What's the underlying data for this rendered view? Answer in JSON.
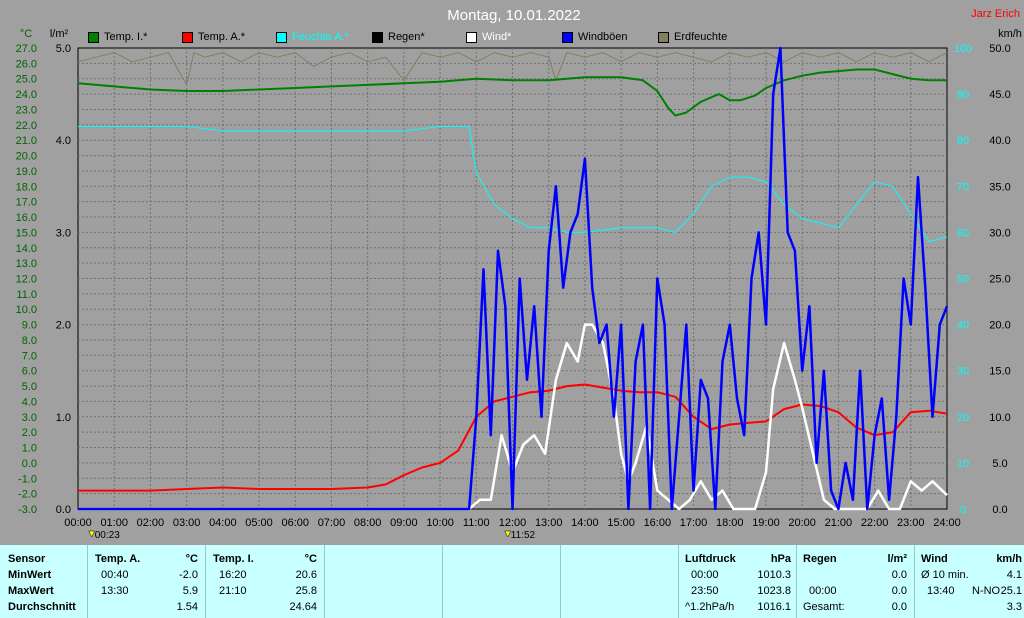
{
  "header": {
    "title": "Montag, 10.01.2022",
    "author": "Jarz Erich"
  },
  "units": {
    "temp": "°C",
    "rain": "l/m²",
    "wind": "km/h"
  },
  "legend": [
    {
      "label": "Temp. I.*",
      "color": "#008000"
    },
    {
      "label": "Temp. A.*",
      "color": "#ff0000"
    },
    {
      "label": "Feuchte A.*",
      "color": "#00ffff"
    },
    {
      "label": "Regen*",
      "color": "#000000"
    },
    {
      "label": "Wind*",
      "color": "#ffffff"
    },
    {
      "label": "Windböen",
      "color": "#0000ff"
    },
    {
      "label": "Erdfeuchte",
      "color": "#808060"
    }
  ],
  "markers": [
    {
      "label": "00:23",
      "hour": 0.38
    },
    {
      "label": "11:52",
      "hour": 11.87
    }
  ],
  "chart_data": {
    "type": "line",
    "x_axis": {
      "min": 0,
      "max": 24,
      "ticks": [
        "00:00",
        "01:00",
        "02:00",
        "03:00",
        "04:00",
        "05:00",
        "06:00",
        "07:00",
        "08:00",
        "09:00",
        "10:00",
        "11:00",
        "12:00",
        "13:00",
        "14:00",
        "15:00",
        "16:00",
        "17:00",
        "18:00",
        "19:00",
        "20:00",
        "21:00",
        "22:00",
        "23:00",
        "24:00"
      ]
    },
    "y_temp": {
      "min": -3,
      "max": 27,
      "step": 1,
      "ticks": [
        "27.0",
        "26.0",
        "25.0",
        "24.0",
        "23.0",
        "22.0",
        "21.0",
        "20.0",
        "19.0",
        "18.0",
        "17.0",
        "16.0",
        "15.0",
        "14.0",
        "13.0",
        "12.0",
        "11.0",
        "10.0",
        "9.0",
        "8.0",
        "7.0",
        "6.0",
        "5.0",
        "4.0",
        "3.0",
        "2.0",
        "1.0",
        "0.0",
        "-1.0",
        "-2.0",
        "-3.0"
      ]
    },
    "y_rain": {
      "min": 0,
      "max": 5,
      "ticks": [
        "5.0",
        "4.0",
        "3.0",
        "2.0",
        "1.0",
        "0.0"
      ]
    },
    "y_humidity": {
      "min": 0,
      "max": 100,
      "ticks": [
        "100",
        "90",
        "80",
        "70",
        "60",
        "50",
        "40",
        "30",
        "20",
        "10",
        "0"
      ]
    },
    "y_wind": {
      "min": 0,
      "max": 50,
      "ticks": [
        "50.0",
        "45.0",
        "40.0",
        "35.0",
        "30.0",
        "25.0",
        "20.0",
        "15.0",
        "10.0",
        "5.0",
        "0.0"
      ]
    },
    "grid": true,
    "series": [
      {
        "name": "Temp. I.*",
        "axis": "temp",
        "color": "#008000",
        "x": [
          0,
          1,
          2,
          3,
          4,
          5,
          6,
          7,
          8,
          9,
          10,
          11,
          12,
          13,
          14,
          15,
          15.6,
          16,
          16.3,
          16.5,
          16.8,
          17.2,
          17.7,
          18,
          18.3,
          18.7,
          19,
          19.5,
          20,
          20.5,
          21,
          21.5,
          22,
          22.5,
          23,
          23.5,
          24
        ],
        "y": [
          24.7,
          24.5,
          24.3,
          24.2,
          24.2,
          24.3,
          24.4,
          24.5,
          24.6,
          24.7,
          24.8,
          25.0,
          24.9,
          24.9,
          25.1,
          25.1,
          24.9,
          24.2,
          23.1,
          22.6,
          22.8,
          23.5,
          24.0,
          23.6,
          23.6,
          23.9,
          24.4,
          24.9,
          25.2,
          25.4,
          25.5,
          25.6,
          25.6,
          25.3,
          25.0,
          24.9,
          24.9
        ]
      },
      {
        "name": "Temp. A.*",
        "axis": "temp",
        "color": "#ff0000",
        "x": [
          0,
          1,
          2,
          3,
          4,
          5,
          6,
          7,
          8,
          8.5,
          9,
          9.5,
          10,
          10.5,
          11,
          11.5,
          12,
          12.5,
          13,
          13.5,
          14,
          14.5,
          15,
          15.5,
          16,
          16.5,
          17,
          17.5,
          18,
          18.5,
          19,
          19.5,
          20,
          20.5,
          21,
          21.5,
          22,
          22.5,
          23,
          23.5,
          24
        ],
        "y": [
          -1.8,
          -1.8,
          -1.8,
          -1.7,
          -1.6,
          -1.7,
          -1.7,
          -1.7,
          -1.6,
          -1.4,
          -0.8,
          -0.3,
          0,
          0.8,
          3,
          4.0,
          4.3,
          4.6,
          4.7,
          5.0,
          5.1,
          4.9,
          4.7,
          4.6,
          4.6,
          4.3,
          3.0,
          2.2,
          2.5,
          2.6,
          2.7,
          3.5,
          3.8,
          3.7,
          3.3,
          2.3,
          1.8,
          2.0,
          3.3,
          3.4,
          3.2
        ]
      },
      {
        "name": "Feuchte A.*",
        "axis": "humidity",
        "color": "#00ffff",
        "x": [
          0,
          1,
          2,
          3,
          4,
          5,
          6,
          7,
          8,
          9,
          10,
          10.8,
          11,
          11.5,
          12,
          12.5,
          13,
          13.5,
          14,
          15,
          16,
          16.5,
          17,
          17.5,
          18,
          18.5,
          19,
          19.5,
          20,
          20.5,
          21,
          21.5,
          22,
          22.5,
          23,
          23.5,
          24
        ],
        "y": [
          83,
          83,
          83,
          83,
          82,
          82,
          82,
          82,
          82,
          82,
          83,
          83,
          73,
          66,
          63,
          61,
          61,
          60,
          60,
          61,
          61,
          60,
          64,
          70,
          72,
          72,
          71,
          66,
          63,
          62,
          61,
          66,
          71,
          70,
          64,
          58,
          59
        ]
      },
      {
        "name": "Wind*",
        "axis": "wind",
        "color": "#ffffff",
        "x": [
          0,
          10.8,
          11.1,
          11.4,
          11.7,
          12,
          12.3,
          12.6,
          12.9,
          13.2,
          13.5,
          13.8,
          14,
          14.2,
          14.5,
          14.8,
          15,
          15.2,
          15.4,
          15.7,
          16,
          16.3,
          16.6,
          16.9,
          17.2,
          17.5,
          17.8,
          18.1,
          18.4,
          18.7,
          19,
          19.2,
          19.5,
          19.8,
          20,
          20.3,
          20.6,
          20.9,
          21.2,
          21.5,
          21.8,
          22.1,
          22.4,
          22.7,
          23,
          23.3,
          23.6,
          24
        ],
        "y": [
          0,
          0,
          1,
          1,
          8,
          4,
          7,
          8,
          6,
          14,
          18,
          16,
          20,
          20,
          18,
          12,
          6,
          3,
          5,
          9,
          2,
          1,
          0,
          1,
          3,
          1,
          2,
          0,
          0,
          0,
          4,
          13,
          18,
          14,
          11,
          6,
          1,
          0,
          0,
          0,
          0,
          2,
          0,
          0,
          3,
          2,
          3,
          1.5
        ]
      },
      {
        "name": "Windböen",
        "axis": "wind",
        "color": "#0000ff",
        "x": [
          0,
          10.8,
          11.0,
          11.2,
          11.4,
          11.6,
          11.8,
          12.0,
          12.2,
          12.4,
          12.6,
          12.8,
          13.0,
          13.2,
          13.4,
          13.6,
          13.8,
          14.0,
          14.2,
          14.4,
          14.6,
          14.8,
          15.0,
          15.2,
          15.4,
          15.6,
          15.8,
          16.0,
          16.2,
          16.4,
          16.6,
          16.8,
          17.0,
          17.2,
          17.4,
          17.6,
          17.8,
          18.0,
          18.2,
          18.4,
          18.6,
          18.8,
          19.0,
          19.2,
          19.4,
          19.6,
          19.8,
          20.0,
          20.2,
          20.4,
          20.6,
          20.8,
          21.0,
          21.2,
          21.4,
          21.6,
          21.8,
          22.0,
          22.2,
          22.4,
          22.6,
          22.8,
          23.0,
          23.2,
          23.4,
          23.6,
          23.8,
          24
        ],
        "y": [
          0,
          0,
          10,
          26,
          8,
          28,
          22,
          0,
          25,
          14,
          22,
          10,
          28,
          35,
          24,
          30,
          32,
          38,
          24,
          18,
          20,
          10,
          20,
          0,
          16,
          20,
          0,
          25,
          20,
          0,
          10,
          20,
          2,
          14,
          12,
          0,
          16,
          20,
          12,
          8,
          25,
          30,
          20,
          45,
          50,
          30,
          28,
          15,
          22,
          5,
          15,
          2,
          0,
          5,
          1,
          15,
          0,
          8,
          12,
          1,
          10,
          25,
          20,
          36,
          24,
          10,
          20,
          22
        ]
      },
      {
        "name": "Erdfeuchte",
        "axis": "humidity",
        "color": "#808060",
        "x": [
          0,
          0.5,
          1,
          1.5,
          2,
          2.5,
          3,
          3.2,
          3.5,
          4,
          4.5,
          5,
          5.5,
          6,
          6.5,
          7,
          7.5,
          8,
          8.5,
          9,
          9.5,
          10,
          10.5,
          11,
          11.5,
          12,
          12.5,
          13,
          13.2,
          13.5,
          14,
          14.5,
          15,
          15.5,
          16,
          16.5,
          17,
          17.5,
          18,
          18.5,
          19,
          19.5,
          20,
          20.5,
          21,
          21.5,
          22,
          22.5,
          23,
          23.5,
          24
        ],
        "y": [
          97,
          98,
          99,
          97,
          98,
          99,
          92,
          99,
          98,
          99,
          97,
          99,
          98,
          99,
          96,
          98,
          99,
          97,
          98,
          93,
          99,
          98,
          99,
          97,
          99,
          98,
          99,
          98,
          93,
          99,
          98,
          99,
          97,
          99,
          98,
          99,
          98,
          97,
          99,
          98,
          99,
          97,
          99,
          98,
          99,
          97,
          99,
          98,
          99,
          97,
          99
        ]
      }
    ]
  },
  "table": {
    "sensor": {
      "header": "Sensor",
      "rows": [
        "MinWert",
        "MaxWert",
        "Durchschnitt"
      ]
    },
    "temp_a": {
      "header": "Temp. A.",
      "unit": "°C",
      "min_time": "00:40",
      "min_val": "-2.0",
      "max_time": "13:30",
      "max_val": "5.9",
      "avg": "1.54"
    },
    "temp_i": {
      "header": "Temp. I.",
      "unit": "°C",
      "min_time": "16:20",
      "min_val": "20.6",
      "max_time": "21:10",
      "max_val": "25.8",
      "avg": "24.64"
    },
    "luftdruck": {
      "header": "Luftdruck",
      "unit": "hPa",
      "min_time": "00:00",
      "min_val": "1010.3",
      "max_time": "23:50",
      "max_val": "1023.8",
      "avg_label": "^1.2hPa/h",
      "avg": "1016.1"
    },
    "regen": {
      "header": "Regen",
      "unit": "l/m²",
      "min_val": "0.0",
      "max_time": "00:00",
      "max_val": "0.0",
      "avg_label": "Gesamt:",
      "avg": "0.0"
    },
    "wind": {
      "header": "Wind",
      "unit": "km/h",
      "min_label": "Ø 10 min.",
      "min_val": "4.1",
      "max_time": "13:40",
      "max_dir": "N-NO",
      "max_val": "25.1",
      "avg": "3.3"
    }
  }
}
